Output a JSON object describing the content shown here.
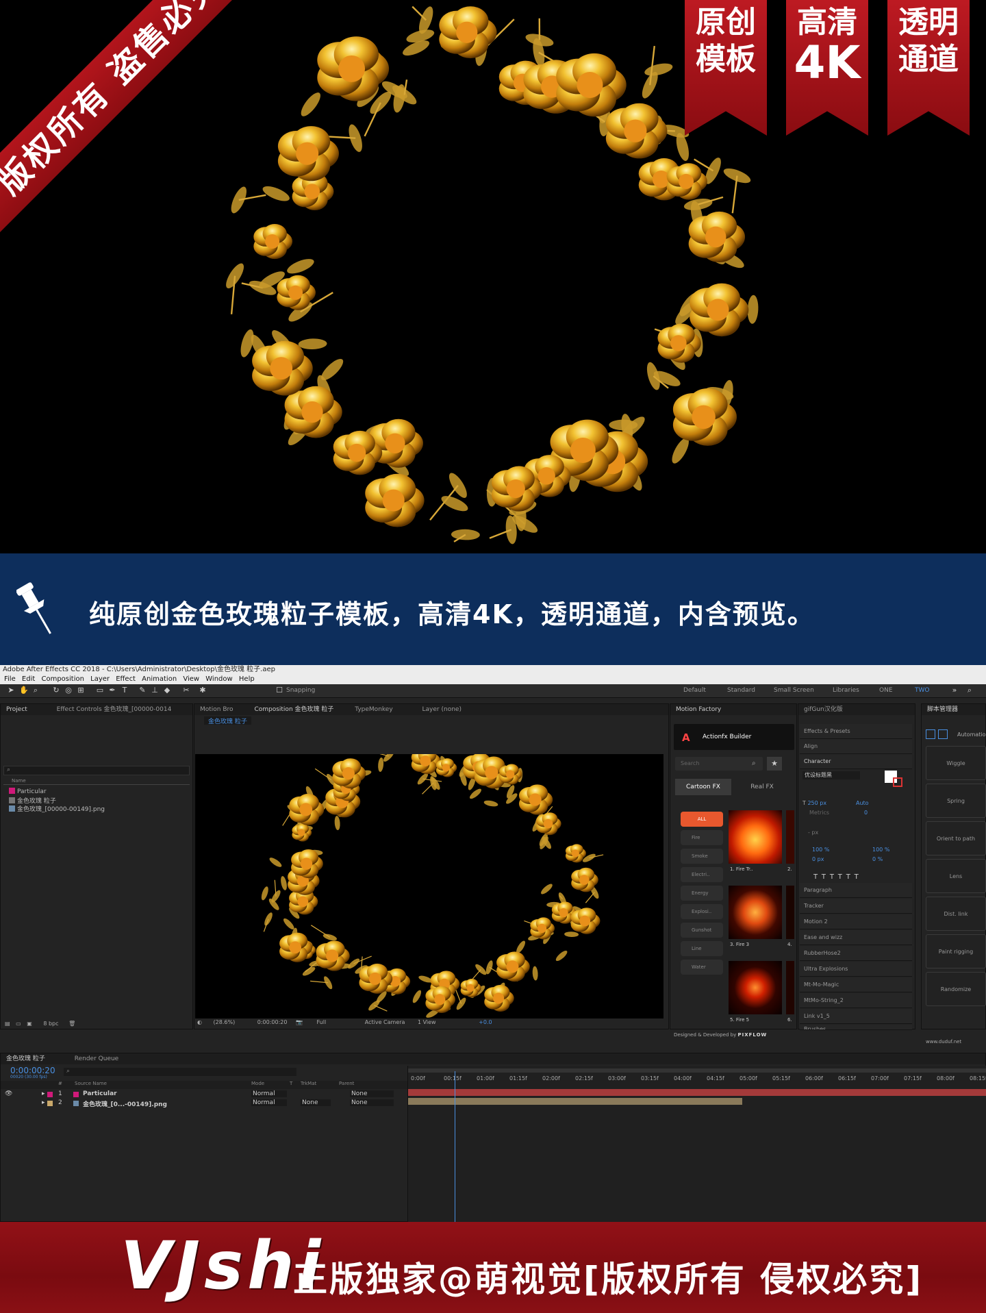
{
  "hero": {
    "corner_banner": "版权所有 盗售必究",
    "ribbons": [
      {
        "line1": "原创",
        "line2": "模板"
      },
      {
        "line1": "高清",
        "line2": "4K"
      },
      {
        "line1": "透明",
        "line2": "通道"
      }
    ]
  },
  "infobar": {
    "icon": "pushpin-icon",
    "text": "纯原创金色玫瑰粒子模板，高清4K，透明通道，内含预览。"
  },
  "ae": {
    "window_title": "Adobe After Effects CC 2018 - C:\\Users\\Administrator\\Desktop\\金色玫瑰 粒子.aep",
    "menu": [
      "File",
      "Edit",
      "Composition",
      "Layer",
      "Effect",
      "Animation",
      "View",
      "Window",
      "Help"
    ],
    "snapping_label": "Snapping",
    "workspaces": [
      "Default",
      "Standard",
      "Small Screen",
      "Libraries",
      "ONE",
      "TWO"
    ],
    "project_panel": {
      "tabs": [
        "Project",
        "Effect Controls 金色玫瑰_[00000-0014"
      ],
      "column_name": "Name",
      "items": [
        "Particular",
        "金色玫瑰 粒子",
        "金色玫瑰_[00000-00149].png"
      ],
      "bpc": "8 bpc"
    },
    "comp_panel": {
      "tabs": [
        "Motion Bro",
        "Composition 金色玫瑰 粒子",
        "TypeMonkey",
        "Layer (none)"
      ],
      "breadcrumb": "金色玫瑰 粒子",
      "zoom": "(28.6%)",
      "timecode": "0:00:00:20",
      "resolution": "Full",
      "camera": "Active Camera",
      "views": "1 View",
      "exposure": "+0.0"
    },
    "motion_factory": {
      "title": "Motion Factory",
      "logo_text": "Actionfx Builder",
      "search_placeholder": "Search",
      "tabs": [
        "Cartoon FX",
        "Real FX"
      ],
      "categories": [
        "ALL",
        "Fire",
        "Smoke",
        "Electri..",
        "Energy",
        "Explosi..",
        "Gunshot",
        "Line",
        "Water"
      ],
      "thumbs": [
        "1. Fire Tr..",
        "2.",
        "3. Fire 3",
        "4.",
        "5. Fire 5",
        "6."
      ],
      "credit": "Designed & Developed by",
      "credit_brand": "PIXFLOW"
    },
    "right_panel": {
      "title": "gifGun汉化版",
      "sections_top": [
        "Effects & Presets",
        "Align"
      ],
      "character": {
        "title": "Character",
        "font": "优设标题黑",
        "size": "250 px",
        "leading": "Auto",
        "kerning": "Metrics",
        "tracking": "0",
        "stroke": "- px",
        "vscale": "100 %",
        "hscale": "100 %",
        "baseline": "0 px",
        "tsume": "0 %"
      },
      "sections": [
        "Paragraph",
        "Tracker",
        "Motion 2",
        "Ease and wizz",
        "RubberHose2",
        "Ultra Explosions",
        "Mt-Mo-Magic",
        "MtMo-String_2",
        "Link v1_5",
        "Brushes"
      ]
    },
    "script_panel": {
      "title": "脚本管理器",
      "auto_label": "Automation",
      "buttons": [
        "Wiggle",
        "Spring",
        "Orient to path",
        "Lens",
        "Dist. link",
        "Paint rigging",
        "Randomize"
      ],
      "url": "www.duduf.net"
    },
    "timeline": {
      "tabs": [
        "金色玫瑰 粒子",
        "Render Queue"
      ],
      "timecode": "0:00:00:20",
      "fps": "00020 (30.00 fps)",
      "columns": [
        "#",
        "Source Name",
        "Mode",
        "T",
        "TrkMat",
        "Parent"
      ],
      "layers": [
        {
          "num": "1",
          "name": "Particular",
          "mode": "Normal",
          "trkmat": "",
          "parent": "None",
          "color": "#d0197a"
        },
        {
          "num": "2",
          "name": "金色玫瑰_[0...-00149].png",
          "mode": "Normal",
          "trkmat": "None",
          "parent": "None",
          "color": "#c9a86a"
        }
      ],
      "ruler": [
        "0:00f",
        "00:15f",
        "01:00f",
        "01:15f",
        "02:00f",
        "02:15f",
        "03:00f",
        "03:15f",
        "04:00f",
        "04:15f",
        "05:00f",
        "05:15f",
        "06:00f",
        "06:15f",
        "07:00f",
        "07:15f",
        "08:00f",
        "08:15f"
      ]
    }
  },
  "footer": {
    "brand": "VJshi",
    "tagline": "正版独家@萌视觉[版权所有 侵权必究]"
  }
}
